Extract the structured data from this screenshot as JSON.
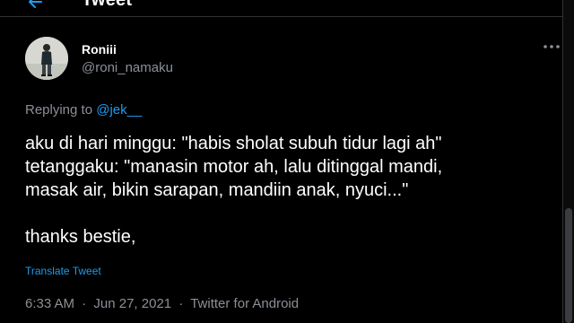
{
  "header": {
    "title": "Tweet",
    "back_icon": "arrow-left-icon"
  },
  "tweet": {
    "author": {
      "display_name": "Roniii",
      "handle": "@roni_namaku",
      "avatar_icon": "avatar-photo"
    },
    "replying_to": {
      "prefix": "Replying to",
      "mention": "@jek__"
    },
    "text_lines": [
      "aku di hari minggu: \"habis sholat subuh tidur lagi ah\"",
      "tetanggaku: \"manasin motor ah, lalu ditinggal mandi,",
      "masak air, bikin sarapan, mandiin anak, nyuci...\"",
      "",
      "thanks bestie,"
    ],
    "translate_label": "Translate Tweet",
    "time": "6:33 AM",
    "separator": "·",
    "date": "Jun 27, 2021",
    "source": "Twitter for Android",
    "more_icon": "more-dots-icon"
  },
  "colors": {
    "background": "#000000",
    "text_primary": "#ffffff",
    "text_secondary": "#8b9097",
    "accent": "#1d9bf0",
    "border": "#2f3336"
  }
}
